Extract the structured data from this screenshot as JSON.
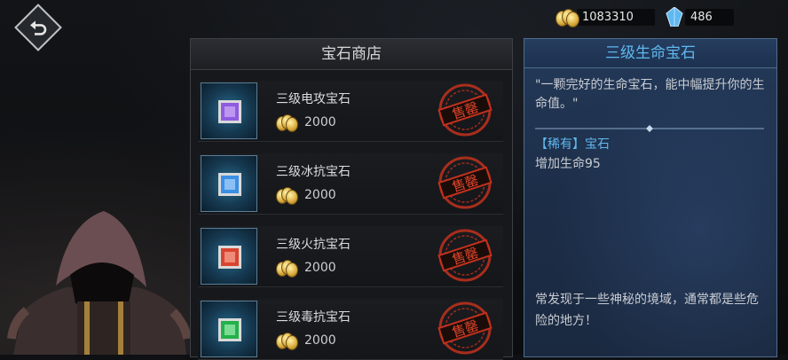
{
  "currency": {
    "gold": "1083310",
    "crystal": "486"
  },
  "shop": {
    "title": "宝石商店",
    "items": [
      {
        "name": "三级电攻宝石",
        "price": "2000",
        "gem_color": "#8f5be0",
        "gem_light": "#e3c6ff",
        "stamp": "售罄"
      },
      {
        "name": "三级冰抗宝石",
        "price": "2000",
        "gem_color": "#3b8fe6",
        "gem_light": "#cfeaff",
        "stamp": "售罄"
      },
      {
        "name": "三级火抗宝石",
        "price": "2000",
        "gem_color": "#d9442e",
        "gem_light": "#ffc7b8",
        "stamp": "售罄"
      },
      {
        "name": "三级毒抗宝石",
        "price": "2000",
        "gem_color": "#23b24a",
        "gem_light": "#c6ffd2",
        "stamp": "售罄"
      }
    ]
  },
  "detail": {
    "title": "三级生命宝石",
    "description": "\"一颗完好的生命宝石，能中幅提升你的生命值。\"",
    "rarity": "【稀有】宝石",
    "effect": "增加生命95",
    "origin": "常发现于一些神秘的境域，通常都是些危险的地方！"
  },
  "colors": {
    "accent_blue": "#5fb8f0",
    "stamp_red": "#c2311c"
  }
}
